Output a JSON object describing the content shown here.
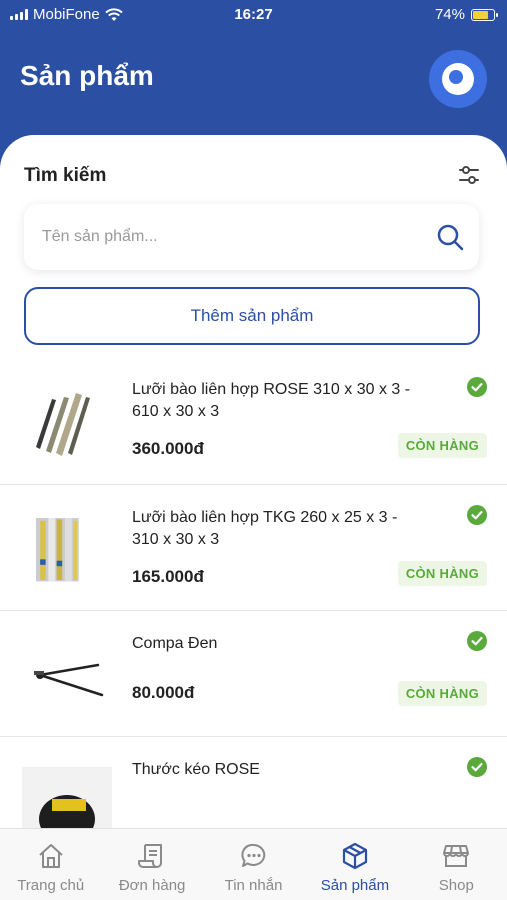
{
  "status_bar": {
    "carrier": "MobiFone",
    "time": "16:27",
    "battery_percent": "74%",
    "battery_level": 0.74,
    "battery_color": "#f3d03b"
  },
  "header": {
    "title": "Sản phẩm",
    "avatar_icon": "app-logo-icon"
  },
  "search": {
    "title": "Tìm kiếm",
    "placeholder": "Tên sản phẩm...",
    "filter_icon": "sliders-icon",
    "search_icon": "search-icon"
  },
  "add_button_label": "Thêm sản phẩm",
  "products": [
    {
      "name": "Lưỡi bào liên hợp ROSE  310 x 30 x 3 - 610 x 30 x 3",
      "price": "360.000đ",
      "stock": "CÒN HÀNG"
    },
    {
      "name": "Lưỡi bào liên hợp TKG  260 x 25 x 3 - 310 x 30 x 3",
      "price": "165.000đ",
      "stock": "CÒN HÀNG"
    },
    {
      "name": "Compa Đen",
      "price": "80.000đ",
      "stock": "CÒN HÀNG"
    },
    {
      "name": "Thước kéo ROSE",
      "price": "",
      "stock": ""
    }
  ],
  "bottom_nav": [
    {
      "label": "Trang chủ",
      "icon": "home-icon",
      "active": false
    },
    {
      "label": "Đơn hàng",
      "icon": "orders-icon",
      "active": false
    },
    {
      "label": "Tin nhắn",
      "icon": "chat-icon",
      "active": false
    },
    {
      "label": "Sản phẩm",
      "icon": "box-icon",
      "active": true
    },
    {
      "label": "Shop",
      "icon": "shop-icon",
      "active": false
    }
  ],
  "colors": {
    "primary": "#2b4fa3",
    "success": "#5aa93c",
    "stock_bg": "#eef7e6"
  }
}
